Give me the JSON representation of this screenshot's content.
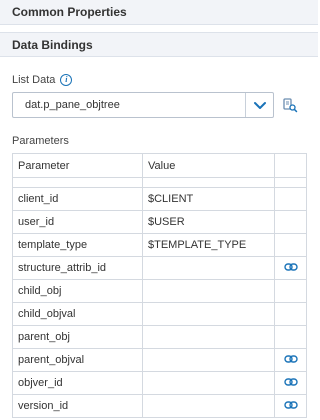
{
  "sections": {
    "common": "Common Properties",
    "bindings": "Data Bindings"
  },
  "list_data": {
    "label": "List Data",
    "value": "dat.p_pane_objtree"
  },
  "parameters": {
    "label": "Parameters",
    "columns": [
      "Parameter",
      "Value"
    ],
    "rows": [
      {
        "name": "client_id",
        "value": "$CLIENT",
        "link": false
      },
      {
        "name": "user_id",
        "value": "$USER",
        "link": false
      },
      {
        "name": "template_type",
        "value": "$TEMPLATE_TYPE",
        "link": false
      },
      {
        "name": "structure_attrib_id",
        "value": "",
        "link": true
      },
      {
        "name": "child_obj",
        "value": "",
        "link": false
      },
      {
        "name": "child_objval",
        "value": "",
        "link": false
      },
      {
        "name": "parent_obj",
        "value": "",
        "link": false
      },
      {
        "name": "parent_objval",
        "value": "",
        "link": true
      },
      {
        "name": "objver_id",
        "value": "",
        "link": true
      },
      {
        "name": "version_id",
        "value": "",
        "link": true
      }
    ]
  },
  "colors": {
    "accent": "#1a73b8",
    "header_bg": "#f2f4f8"
  }
}
